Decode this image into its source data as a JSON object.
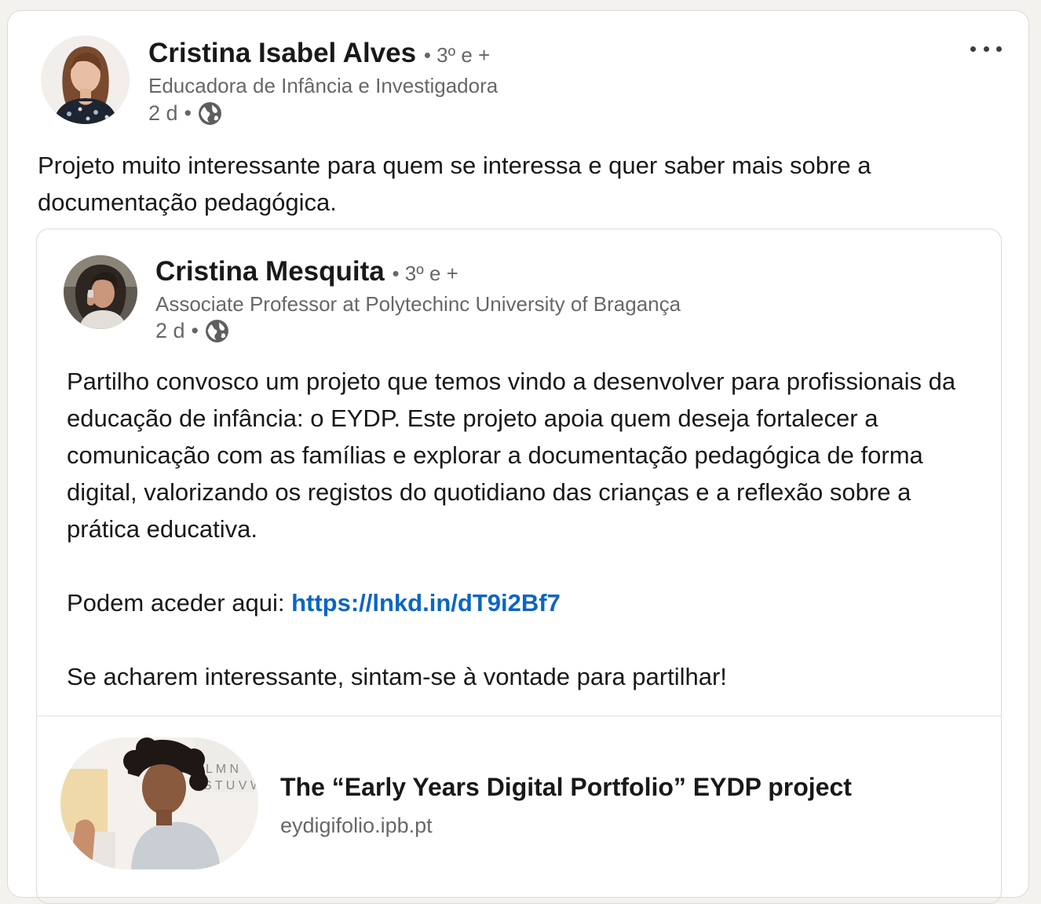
{
  "post": {
    "author": {
      "name": "Cristina Isabel Alves",
      "degree": "• 3º e +",
      "headline": "Educadora de Infância e Investigadora",
      "time": "2 d",
      "visibility_icon": "globe-icon"
    },
    "menu_icon": "more-options-icon",
    "commentary": "Projeto muito interessante para quem se interessa e quer saber mais sobre a documentação pedagógica."
  },
  "shared_post": {
    "author": {
      "name": "Cristina Mesquita",
      "degree": "• 3º e +",
      "headline": "Associate Professor at Polytechinc University of Bragança",
      "time": "2 d",
      "visibility_icon": "globe-icon"
    },
    "body_paragraph": "Partilho convosco um projeto que temos vindo a desenvolver para profissionais da educação de infância: o EYDP. Este projeto apoia quem deseja fortalecer a comunicação com as famílias e explorar a documentação pedagógica de forma digital, valorizando os registos do quotidiano das crianças e a reflexão sobre a prática educativa.",
    "access_prefix": "Podem aceder aqui: ",
    "access_link": "https://lnkd.in/dT9i2Bf7",
    "closing": "Se acharem interessante, sintam-se à vontade para partilhar!"
  },
  "link_preview": {
    "title": "The “Early Years Digital Portfolio” EYDP project",
    "domain": "eydigifolio.ipb.pt"
  },
  "colors": {
    "link": "#0a66c2",
    "page_background": "#f3f2ef",
    "card_background": "#ffffff"
  }
}
